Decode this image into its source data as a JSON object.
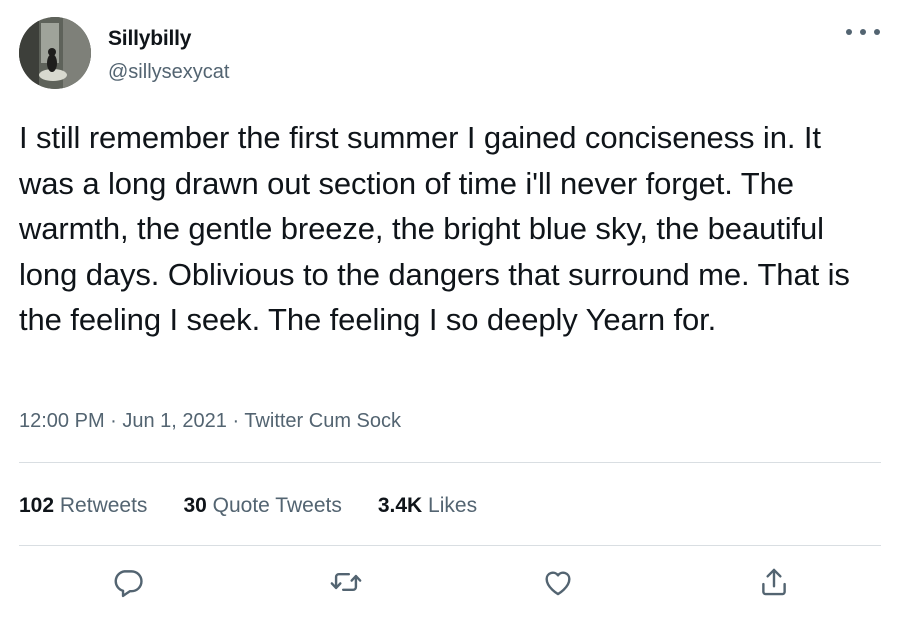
{
  "author": {
    "display_name": "Sillybilly",
    "handle": "@sillysexycat",
    "avatar_icon": "cat-photo-avatar"
  },
  "tweet": {
    "text": "I still remember the first summer I gained conciseness in. It was a long drawn out section of time i'll never forget. The warmth, the gentle breeze, the bright blue sky, the beautiful long days. Oblivious to the dangers that surround me. That is the feeling I seek. The feeling I so deeply Yearn for.",
    "meta": "12:00 PM · Jun 1, 2021 · Twitter Cum Sock"
  },
  "stats": {
    "retweets_count": "102",
    "retweets_label": "Retweets",
    "quote_count": "30",
    "quote_label": "Quote Tweets",
    "likes_count": "3.4K",
    "likes_label": "Likes"
  },
  "actions": [
    "reply-icon",
    "retweet-icon",
    "like-icon",
    "share-icon"
  ],
  "colors": {
    "text_primary": "#0f1419",
    "text_secondary": "#536471",
    "divider": "#d9dee2",
    "background": "#ffffff"
  }
}
